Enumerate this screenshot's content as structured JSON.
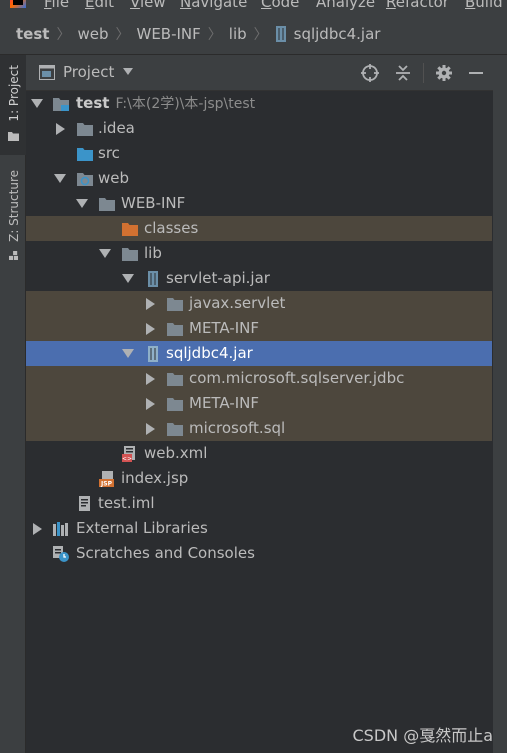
{
  "menubar": {
    "items": [
      {
        "first": "F",
        "rest": "ile"
      },
      {
        "first": "E",
        "rest": "dit"
      },
      {
        "first": "V",
        "rest": "iew"
      },
      {
        "first": "N",
        "rest": "avigate"
      },
      {
        "first": "C",
        "rest": "ode"
      },
      {
        "first": "",
        "rest": "Analyze"
      },
      {
        "first": "R",
        "rest": "efactor"
      },
      {
        "first": "B",
        "rest": "uild"
      }
    ]
  },
  "breadcrumb": [
    "test",
    "web",
    "WEB-INF",
    "lib",
    "sqljdbc4.jar"
  ],
  "side_tabs": {
    "project": "1: Project",
    "structure": "Z: Structure"
  },
  "project_panel": {
    "title": "Project"
  },
  "tree": [
    {
      "label": "test",
      "sublabel": "F:\\本(2学)\\本-jsp\\test"
    },
    {
      "label": ".idea"
    },
    {
      "label": "src"
    },
    {
      "label": "web"
    },
    {
      "label": "WEB-INF"
    },
    {
      "label": "classes"
    },
    {
      "label": "lib"
    },
    {
      "label": "servlet-api.jar"
    },
    {
      "label": "javax.servlet"
    },
    {
      "label": "META-INF"
    },
    {
      "label": "sqljdbc4.jar"
    },
    {
      "label": "com.microsoft.sqlserver.jdbc"
    },
    {
      "label": "META-INF"
    },
    {
      "label": "microsoft.sql"
    },
    {
      "label": "web.xml"
    },
    {
      "label": "index.jsp"
    },
    {
      "label": "test.iml"
    },
    {
      "label": "External Libraries"
    },
    {
      "label": "Scratches and Consoles"
    }
  ],
  "watermark": "CSDN @戛然而止a",
  "colors": {
    "selection": "#4b6eaf",
    "excluded_row": "#4d473d",
    "folder": "#7d8891",
    "source_folder": "#3b94c9",
    "excluded_folder": "#d27131"
  }
}
